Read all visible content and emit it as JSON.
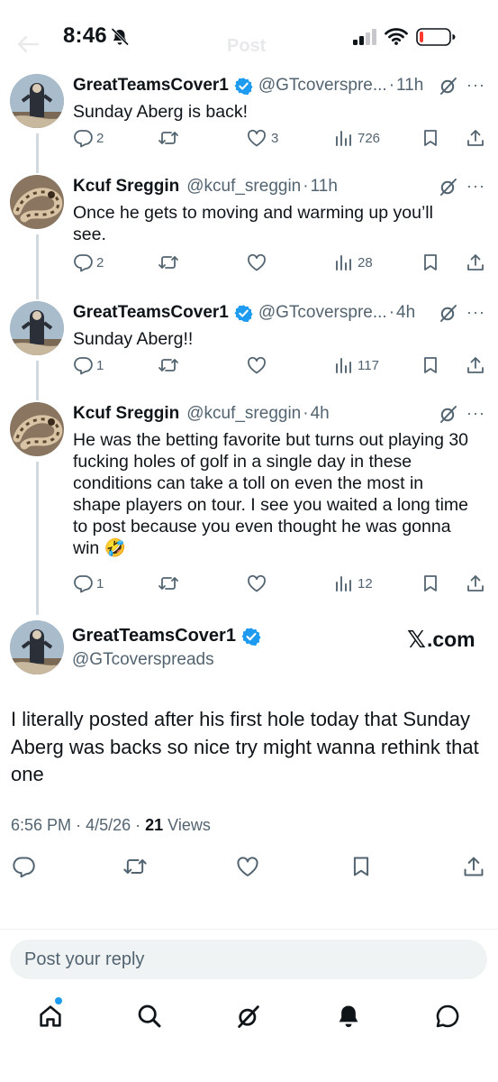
{
  "status_bar": {
    "time": "8:46",
    "background_title": "Post"
  },
  "replies": [
    {
      "name": "GreatTeamsCover1",
      "verified": true,
      "handle": "@GTcoverspre...",
      "time": "11h",
      "text": "Sunday Aberg is back!",
      "stats": {
        "replies": "2",
        "reposts": "",
        "likes": "3",
        "views": "726"
      }
    },
    {
      "name": "Kcuf Sreggin",
      "verified": false,
      "handle": "@kcuf_sreggin",
      "time": "11h",
      "text": "Once he gets to moving and warming up you’ll see.",
      "stats": {
        "replies": "2",
        "reposts": "",
        "likes": "",
        "views": "28"
      }
    },
    {
      "name": "GreatTeamsCover1",
      "verified": true,
      "handle": "@GTcoverspre...",
      "time": "4h",
      "text": "Sunday Aberg!!",
      "stats": {
        "replies": "1",
        "reposts": "",
        "likes": "",
        "views": "117"
      }
    },
    {
      "name": "Kcuf Sreggin",
      "verified": false,
      "handle": "@kcuf_sreggin",
      "time": "4h",
      "text": "He was the betting favorite but turns out playing 30 fucking holes of golf in a single day in these conditions can take a toll on even the most in shape players on tour. I see you waited a long time to post because you even thought he was gonna win 🤣",
      "stats": {
        "replies": "1",
        "reposts": "",
        "likes": "",
        "views": "12"
      }
    }
  ],
  "main_tweet": {
    "name": "GreatTeamsCover1",
    "handle": "@GTcoverspreads",
    "source_x": "𝕏",
    "source_label": ".com",
    "text": "I literally posted after his first hole today that Sunday Aberg was backs so nice try might wanna rethink that one",
    "time": "6:56 PM",
    "date": "4/5/26",
    "views_count": "21",
    "views_label": "Views"
  },
  "reply_input": {
    "placeholder": "Post your reply"
  },
  "icons": {
    "reply": "reply-icon",
    "repost": "repost-icon",
    "like": "heart-icon",
    "views": "views-icon",
    "bookmark": "bookmark-icon",
    "share": "share-icon",
    "grok": "grok-icon",
    "more": "more-icon"
  },
  "colors": {
    "text": "#0f1419",
    "secondary": "#536471",
    "verified": "#1d9bf0",
    "thread_line": "#cfd9de",
    "input_bg": "#eff3f4"
  }
}
